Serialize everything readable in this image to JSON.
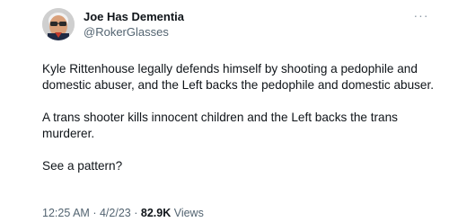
{
  "tweet": {
    "display_name": "Joe Has Dementia",
    "handle": "@RokerGlasses",
    "paragraphs": [
      "Kyle Rittenhouse legally defends himself by shooting a pedophile and domestic abuser, and the Left backs the pedophile and domestic abuser.",
      "A trans shooter kills innocent children and the Left backs the trans murderer.",
      "See a pattern?"
    ],
    "time": "12:25 AM",
    "separator": "·",
    "date": "4/2/23",
    "views_count": "82.9K",
    "views_label": "Views",
    "more_icon": "more-icon"
  }
}
